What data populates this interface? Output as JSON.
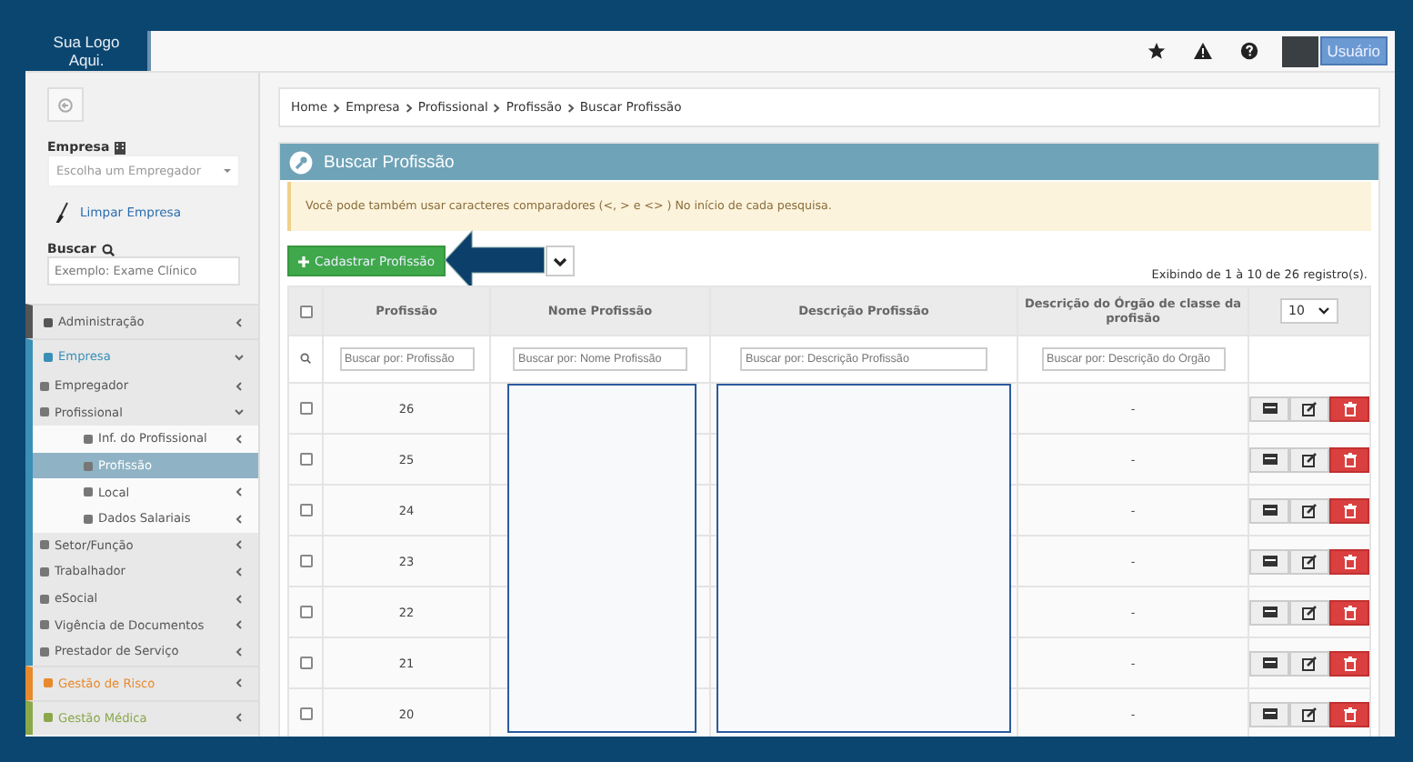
{
  "logo": "Sua Logo Aqui.",
  "user_button": "Usuário",
  "sidebar": {
    "company_label": "Empresa",
    "company_select": {
      "placeholder": "Escolha um Empregador"
    },
    "clear_link": "Limpar Empresa",
    "search_label": "Buscar",
    "search": {
      "placeholder": "Exemplo: Exame Clínico"
    },
    "menu": [
      {
        "label": "Administração",
        "color": "#555555",
        "expanded": false
      },
      {
        "label": "Empresa",
        "color": "#3a8fb7",
        "expanded": true,
        "children": [
          {
            "label": "Empregador",
            "expanded": false
          },
          {
            "label": "Profissional",
            "expanded": true,
            "children": [
              {
                "label": "Inf. do Profissional",
                "expanded": false,
                "selected": false
              },
              {
                "label": "Profissão",
                "selected": true
              },
              {
                "label": "Local",
                "expanded": false,
                "selected": false
              },
              {
                "label": "Dados Salariais",
                "expanded": false,
                "selected": false
              }
            ]
          },
          {
            "label": "Setor/Função",
            "expanded": false
          },
          {
            "label": "Trabalhador",
            "expanded": false
          },
          {
            "label": "eSocial",
            "expanded": false
          },
          {
            "label": "Vigência de Documentos",
            "expanded": false
          },
          {
            "label": "Prestador de Serviço",
            "expanded": false
          }
        ]
      },
      {
        "label": "Gestão de Risco",
        "color": "#e8892c",
        "expanded": false
      },
      {
        "label": "Gestão Médica",
        "color": "#8aa84a",
        "expanded": false
      }
    ]
  },
  "breadcrumb": [
    "Home",
    "Empresa",
    "Profissional",
    "Profissão",
    "Buscar Profissão"
  ],
  "panel_title": "Buscar Profissão",
  "alert": "Você pode também usar caracteres comparadores (<, > e <> ) No início de cada pesquisa.",
  "add_button": "Cadastrar Profissão",
  "records_info": "Exibindo de 1 à 10 de 26 registro(s).",
  "table": {
    "columns": [
      "Profissão",
      "Nome Profissão",
      "Descrição Profissão",
      "Descrição do Órgão de classe da profisão"
    ],
    "page_size": "10",
    "select_all_checked": false,
    "filters": [
      {
        "placeholder": "Buscar por: Profissão"
      },
      {
        "placeholder": "Buscar por: Nome Profissão"
      },
      {
        "placeholder": "Buscar por: Descrição Profissão"
      },
      {
        "placeholder": "Buscar por: Descrição do Órgão"
      }
    ],
    "rows": [
      {
        "profissao": "26",
        "orgao": "-",
        "checked": false
      },
      {
        "profissao": "25",
        "orgao": "-",
        "checked": false
      },
      {
        "profissao": "24",
        "orgao": "-",
        "checked": false
      },
      {
        "profissao": "23",
        "orgao": "-",
        "checked": false
      },
      {
        "profissao": "22",
        "orgao": "-",
        "checked": false
      },
      {
        "profissao": "21",
        "orgao": "-",
        "checked": false
      },
      {
        "profissao": "20",
        "orgao": "-",
        "checked": false
      }
    ]
  }
}
